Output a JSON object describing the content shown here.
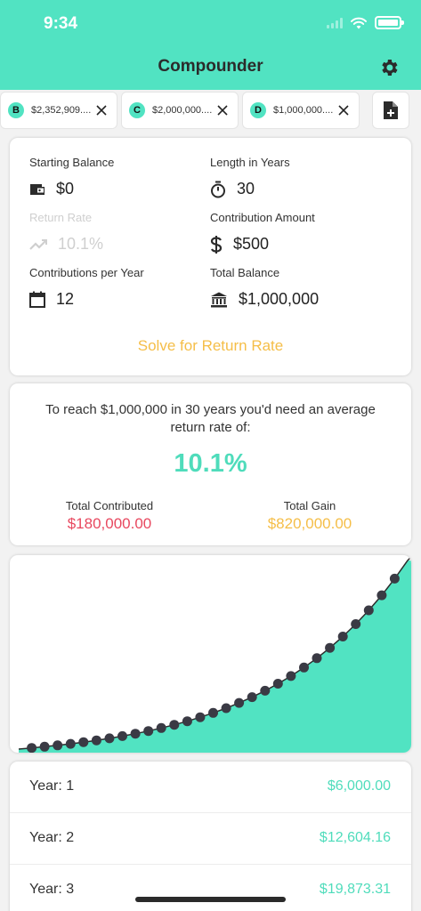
{
  "status_bar": {
    "time": "9:34"
  },
  "header": {
    "title": "Compounder",
    "settings_icon": "gear-icon"
  },
  "tabs": [
    {
      "letter": "B",
      "label": "$2,352,909...."
    },
    {
      "letter": "C",
      "label": "$2,000,000...."
    },
    {
      "letter": "D",
      "label": "$1,000,000...."
    }
  ],
  "new_tab_icon": "file-plus-icon",
  "inputs": {
    "starting_balance": {
      "label": "Starting Balance",
      "value": "$0",
      "icon": "wallet-icon"
    },
    "length_in_years": {
      "label": "Length in Years",
      "value": "30",
      "icon": "stopwatch-icon"
    },
    "return_rate": {
      "label": "Return Rate",
      "value": "10.1%",
      "icon": "trending-up-icon"
    },
    "contribution_amount": {
      "label": "Contribution Amount",
      "value": "$500",
      "icon": "dollar-icon"
    },
    "contributions_per_year": {
      "label": "Contributions per Year",
      "value": "12",
      "icon": "calendar-icon"
    },
    "total_balance": {
      "label": "Total Balance",
      "value": "$1,000,000",
      "icon": "bank-icon"
    },
    "solve_label": "Solve for Return Rate"
  },
  "summary": {
    "text": "To reach $1,000,000 in 30 years you'd need an average return rate of:",
    "rate": "10.1%",
    "contributed_label": "Total Contributed",
    "contributed_value": "$180,000.00",
    "gain_label": "Total Gain",
    "gain_value": "$820,000.00"
  },
  "colors": {
    "accent": "#51e3c2",
    "contributed": "#e8485f",
    "gain": "#f5be48",
    "solve": "#f5be48"
  },
  "chart_data": {
    "type": "area",
    "x": [
      0,
      1,
      2,
      3,
      4,
      5,
      6,
      7,
      8,
      9,
      10,
      11,
      12,
      13,
      14,
      15,
      16,
      17,
      18,
      19,
      20,
      21,
      22,
      23,
      24,
      25,
      26,
      27,
      28,
      29,
      30
    ],
    "values": [
      0,
      6000,
      12604.16,
      19873.31,
      27874.53,
      36681.76,
      46376.28,
      57047.3,
      68793.28,
      81722.75,
      95955.0,
      111621.4,
      128866.6,
      147849.6,
      168745.2,
      191745.8,
      217063.4,
      244931.3,
      275607.2,
      309373.3,
      346541.9,
      387456.2,
      432492.3,
      482068.8,
      536636.8,
      596711.1,
      662842.9,
      735641.8,
      815772.1,
      903972.5,
      1000000
    ],
    "ylim": [
      0,
      1000000
    ],
    "fill_color": "#51e3c2",
    "line_color": "#2b2b2b",
    "marker_color": "#3a3a44"
  },
  "yearly": [
    {
      "label": "Year: 1",
      "value": "$6,000.00"
    },
    {
      "label": "Year: 2",
      "value": "$12,604.16"
    },
    {
      "label": "Year: 3",
      "value": "$19,873.31"
    }
  ]
}
